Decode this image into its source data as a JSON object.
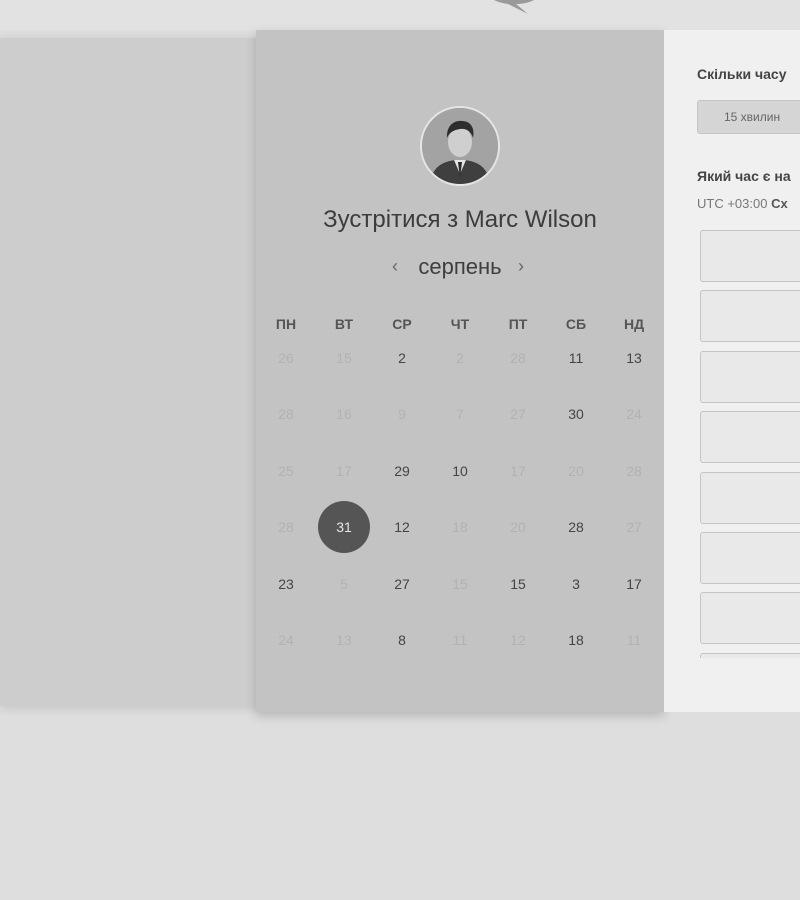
{
  "calendar": {
    "host_title": "Зустрітися з Marc Wilson",
    "month": "серпень",
    "prev_icon": "chevron-left-icon",
    "next_icon": "chevron-right-icon",
    "weekdays": [
      "ПН",
      "ВТ",
      "СР",
      "ЧТ",
      "ПТ",
      "СБ",
      "НД"
    ],
    "weeks": [
      [
        {
          "d": "26",
          "a": false
        },
        {
          "d": "15",
          "a": false
        },
        {
          "d": "2",
          "a": true
        },
        {
          "d": "2",
          "a": false
        },
        {
          "d": "28",
          "a": false
        },
        {
          "d": "11",
          "a": true
        },
        {
          "d": "13",
          "a": true
        }
      ],
      [
        {
          "d": "28",
          "a": false
        },
        {
          "d": "16",
          "a": false
        },
        {
          "d": "9",
          "a": false
        },
        {
          "d": "7",
          "a": false
        },
        {
          "d": "27",
          "a": false
        },
        {
          "d": "30",
          "a": true
        },
        {
          "d": "24",
          "a": false
        }
      ],
      [
        {
          "d": "25",
          "a": false
        },
        {
          "d": "17",
          "a": false
        },
        {
          "d": "29",
          "a": true
        },
        {
          "d": "10",
          "a": true
        },
        {
          "d": "17",
          "a": false
        },
        {
          "d": "20",
          "a": false
        },
        {
          "d": "28",
          "a": false
        }
      ],
      [
        {
          "d": "28",
          "a": false
        },
        {
          "d": "31",
          "a": true,
          "selected": true
        },
        {
          "d": "12",
          "a": true
        },
        {
          "d": "18",
          "a": false
        },
        {
          "d": "20",
          "a": false
        },
        {
          "d": "28",
          "a": true
        },
        {
          "d": "27",
          "a": false
        }
      ],
      [
        {
          "d": "23",
          "a": true
        },
        {
          "d": "5",
          "a": false
        },
        {
          "d": "27",
          "a": true
        },
        {
          "d": "15",
          "a": false
        },
        {
          "d": "15",
          "a": true
        },
        {
          "d": "3",
          "a": true
        },
        {
          "d": "17",
          "a": true
        }
      ],
      [
        {
          "d": "24",
          "a": false
        },
        {
          "d": "13",
          "a": false
        },
        {
          "d": "8",
          "a": true
        },
        {
          "d": "11",
          "a": false
        },
        {
          "d": "12",
          "a": false
        },
        {
          "d": "18",
          "a": true
        },
        {
          "d": "11",
          "a": false
        }
      ]
    ]
  },
  "booking": {
    "duration_question": "Скільки часу",
    "duration_option": "15 хвилин",
    "time_question": "Який час є на",
    "timezone_offset": "UTC +03:00",
    "timezone_name": "Сх",
    "slot_count_visible": 8
  },
  "colors": {
    "calendar_bg": "#c3c3c3",
    "selected_day": "#555555",
    "right_panel_bg": "#f0f0f0",
    "page_bg": "#dedede"
  }
}
